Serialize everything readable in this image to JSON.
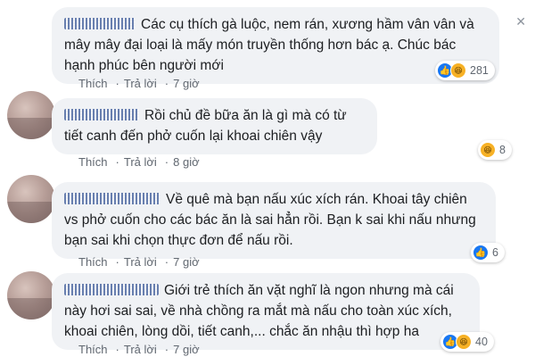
{
  "comments": [
    {
      "text": "Các cụ thích gà luộc, nem rán, xương hầm vân vân và mây mây đại loại là mấy món truyền thống hơn bác ạ. Chúc bác hạnh phúc bên người mới",
      "actions": {
        "like": "Thích",
        "reply": "Trả lời",
        "time": "7 giờ"
      },
      "reaction_count": "281",
      "reactions": [
        "like-icon",
        "haha-icon"
      ]
    },
    {
      "text": "Rồi chủ đề bữa ăn là gì mà có từ tiết canh đến phở cuốn lại khoai chiên vậy",
      "actions": {
        "like": "Thích",
        "reply": "Trả lời",
        "time": "8 giờ"
      },
      "reaction_count": "8",
      "reactions": [
        "haha-icon"
      ]
    },
    {
      "text": "Về quê mà bạn nấu xúc xích rán. Khoai tây chiên vs phở cuốn cho các bác ăn là sai hẳn rồi. Bạn k sai khi nấu nhưng bạn sai khi chọn thực đơn để nấu rồi.",
      "actions": {
        "like": "Thích",
        "reply": "Trả lời",
        "time": "7 giờ"
      },
      "reaction_count": "6",
      "reactions": [
        "like-icon"
      ]
    },
    {
      "text": "Giới trẻ thích ăn vặt nghĩ là ngon nhưng mà cái này hơi sai sai, về nhà chồng ra mắt mà nấu cho toàn xúc xích, khoai chiên, lòng dồi, tiết canh,... chắc ăn nhậu thì hợp ha",
      "actions": {
        "like": "Thích",
        "reply": "Trả lời",
        "time": "7 giờ"
      },
      "reaction_count": "40",
      "reactions": [
        "like-icon",
        "haha-icon"
      ]
    }
  ],
  "colors": {
    "bubble": "#f0f2f5",
    "meta_text": "#606770",
    "like_blue": "#1877f2",
    "haha_yellow": "#f7b125"
  }
}
